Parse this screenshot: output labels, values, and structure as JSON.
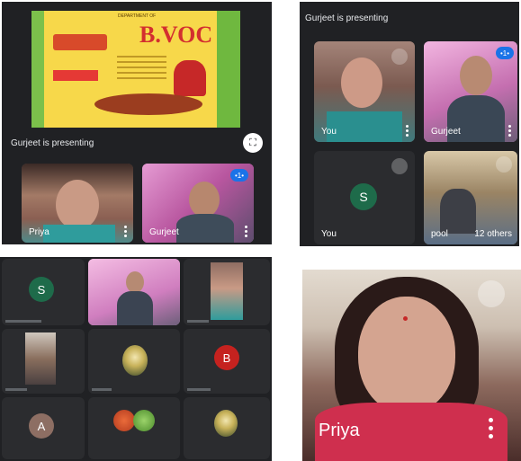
{
  "panel_a": {
    "poster": {
      "banner": "B.VOC",
      "header_small": "DEPARTMENT OF"
    },
    "presenting_label": "Gurjeet is presenting",
    "tiles": [
      {
        "name": "Priya"
      },
      {
        "name": "Gurjeet"
      }
    ],
    "badge": "•1•"
  },
  "panel_b": {
    "presenting_label": "Gurjeet is presenting",
    "tiles": [
      {
        "name": "You"
      },
      {
        "name": "Gurjeet"
      },
      {
        "name": "You",
        "avatar": "S"
      },
      {
        "name": "pool",
        "overlay": "12 others"
      }
    ],
    "badge": "•1•"
  },
  "panel_c": {
    "avatars": [
      {
        "letter": "S",
        "color": "#1e6b4a"
      },
      {
        "letter": "B",
        "color": "#c5221f"
      },
      {
        "letter": "A",
        "color": "#8d6e63"
      }
    ]
  },
  "panel_d": {
    "name": "Priya"
  },
  "colors": {
    "meet_dark": "#202124",
    "tile": "#3c4043",
    "avatar_green": "#1e6b4a",
    "badge_blue": "#1a73e8"
  }
}
